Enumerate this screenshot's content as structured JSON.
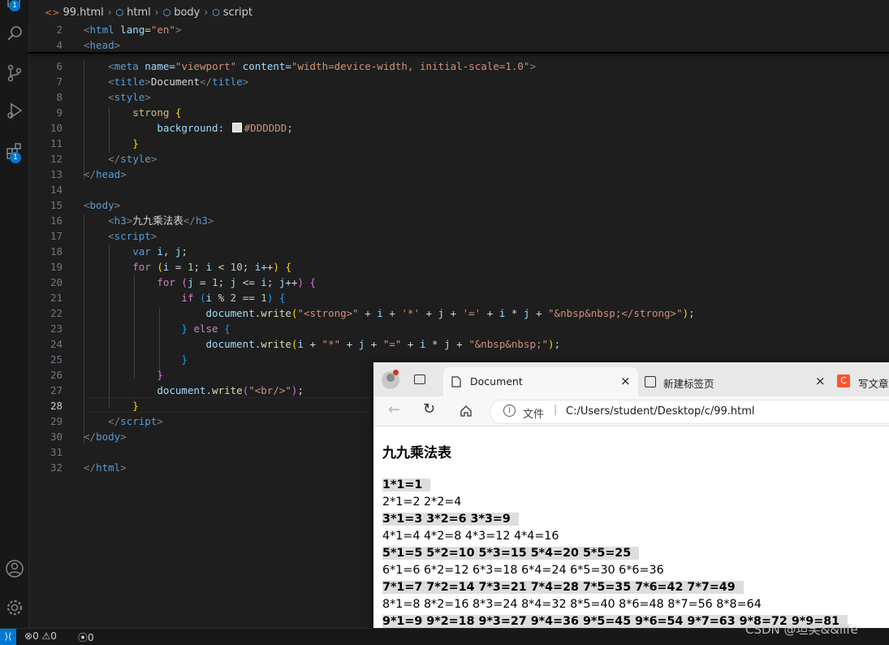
{
  "editor": {
    "breadcrumb": [
      {
        "label": "99.html",
        "icon": "html-file-icon"
      },
      {
        "label": "html",
        "icon": "element-icon"
      },
      {
        "label": "body",
        "icon": "element-icon"
      },
      {
        "label": "script",
        "icon": "element-icon"
      }
    ],
    "active_line": "28",
    "activity_badges": {
      "top": "1",
      "extensions": "1"
    }
  },
  "status": {
    "errors": "0",
    "warnings": "0",
    "ports": "0"
  },
  "browser": {
    "tabs": [
      {
        "title": "Document",
        "close": "×"
      },
      {
        "title": "新建标签页",
        "close": "×"
      },
      {
        "title": "写文章-"
      }
    ],
    "address": {
      "info_label": "文件",
      "url": "C:/Users/student/Desktop/c/99.html"
    },
    "page": {
      "heading": "九九乘法表",
      "rows": [
        "1*1=1",
        "2*1=2  2*2=4",
        "3*1=3  3*2=6  3*3=9",
        "4*1=4  4*2=8  4*3=12  4*4=16",
        "5*1=5  5*2=10  5*3=15  5*4=20  5*5=25",
        "6*1=6  6*2=12  6*3=18  6*4=24  6*5=30  6*6=36",
        "7*1=7  7*2=14  7*3=21  7*4=28  7*5=35  7*6=42  7*7=49",
        "8*1=8  8*2=16  8*3=24  8*4=32  8*5=40  8*6=48  8*7=56  8*8=64",
        "9*1=9  9*2=18  9*3=27  9*4=36  9*5=45  9*6=54  9*7=63  9*8=72  9*9=81"
      ]
    }
  },
  "watermark": "CSDN @坦笑&&life"
}
